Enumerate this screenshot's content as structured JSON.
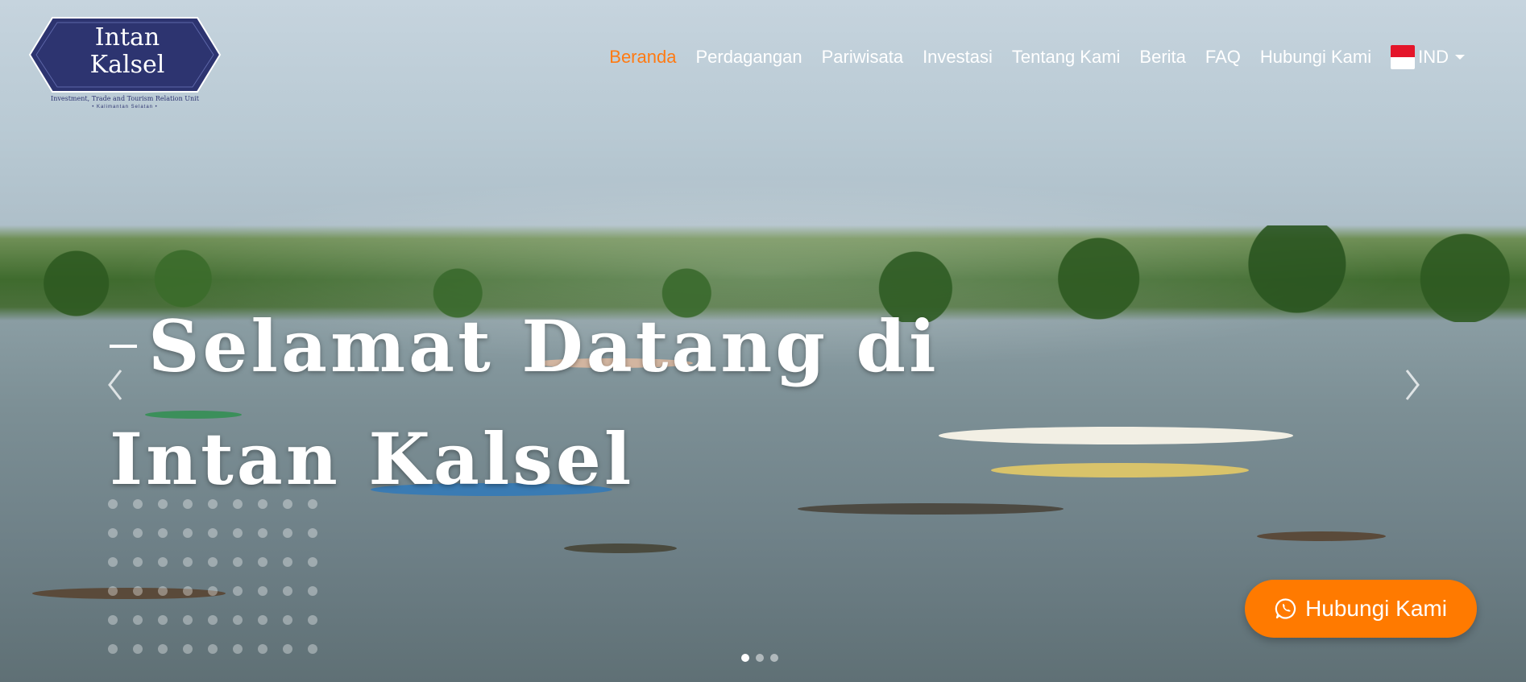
{
  "logo": {
    "title_line1": "Intan",
    "title_line2": "Kalsel",
    "subtitle": "Investment, Trade and Tourism Relation Unit",
    "region": "• Kalimantan Selatan •"
  },
  "nav": {
    "items": [
      {
        "label": "Beranda",
        "active": true
      },
      {
        "label": "Perdagangan",
        "active": false
      },
      {
        "label": "Pariwisata",
        "active": false
      },
      {
        "label": "Investasi",
        "active": false
      },
      {
        "label": "Tentang Kami",
        "active": false
      },
      {
        "label": "Berita",
        "active": false
      },
      {
        "label": "FAQ",
        "active": false
      },
      {
        "label": "Hubungi Kami",
        "active": false
      }
    ],
    "language": {
      "label": "IND",
      "flag": "indonesia-flag-icon"
    }
  },
  "hero": {
    "title_line1": "Selamat Datang di",
    "title_line2": "Intan Kalsel"
  },
  "carousel": {
    "prev_icon": "chevron-left-icon",
    "next_icon": "chevron-right-icon",
    "slides": 3,
    "active_index": 0
  },
  "contact_button": {
    "label": "Hubungi Kami",
    "icon": "whatsapp-icon"
  },
  "colors": {
    "accent": "#ff7a12",
    "button": "#ff7a00",
    "logo_navy": "#2d3470"
  }
}
